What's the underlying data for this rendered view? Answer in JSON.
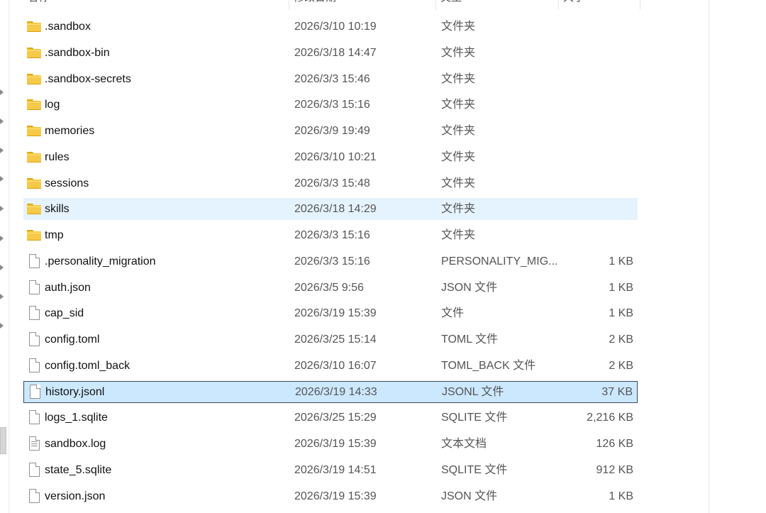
{
  "columns": {
    "name": "名称",
    "date": "修改日期",
    "type": "类型",
    "size": "大小"
  },
  "icons": {
    "folder": "folder-icon",
    "file": "file-icon",
    "text_file": "text-file-icon"
  },
  "accent": {
    "hover": "#e5f3ff",
    "selected": "#cce8ff",
    "selected_border": "#3a4a5e"
  },
  "rows": [
    {
      "name": ".sandbox",
      "date": "2026/3/10 10:19",
      "type": "文件夹",
      "size": "",
      "kind": "folder",
      "state": ""
    },
    {
      "name": ".sandbox-bin",
      "date": "2026/3/18 14:47",
      "type": "文件夹",
      "size": "",
      "kind": "folder",
      "state": ""
    },
    {
      "name": ".sandbox-secrets",
      "date": "2026/3/3 15:46",
      "type": "文件夹",
      "size": "",
      "kind": "folder",
      "state": ""
    },
    {
      "name": "log",
      "date": "2026/3/3 15:16",
      "type": "文件夹",
      "size": "",
      "kind": "folder",
      "state": ""
    },
    {
      "name": "memories",
      "date": "2026/3/9 19:49",
      "type": "文件夹",
      "size": "",
      "kind": "folder",
      "state": ""
    },
    {
      "name": "rules",
      "date": "2026/3/10 10:21",
      "type": "文件夹",
      "size": "",
      "kind": "folder",
      "state": ""
    },
    {
      "name": "sessions",
      "date": "2026/3/3 15:48",
      "type": "文件夹",
      "size": "",
      "kind": "folder",
      "state": ""
    },
    {
      "name": "skills",
      "date": "2026/3/18 14:29",
      "type": "文件夹",
      "size": "",
      "kind": "folder",
      "state": "hover"
    },
    {
      "name": "tmp",
      "date": "2026/3/3 15:16",
      "type": "文件夹",
      "size": "",
      "kind": "folder",
      "state": ""
    },
    {
      "name": ".personality_migration",
      "date": "2026/3/3 15:16",
      "type": "PERSONALITY_MIG...",
      "size": "1 KB",
      "kind": "file",
      "state": ""
    },
    {
      "name": "auth.json",
      "date": "2026/3/5 9:56",
      "type": "JSON 文件",
      "size": "1 KB",
      "kind": "file",
      "state": ""
    },
    {
      "name": "cap_sid",
      "date": "2026/3/19 15:39",
      "type": "文件",
      "size": "1 KB",
      "kind": "file",
      "state": ""
    },
    {
      "name": "config.toml",
      "date": "2026/3/25 15:14",
      "type": "TOML 文件",
      "size": "2 KB",
      "kind": "file",
      "state": ""
    },
    {
      "name": "config.toml_back",
      "date": "2026/3/10 16:07",
      "type": "TOML_BACK 文件",
      "size": "2 KB",
      "kind": "file",
      "state": ""
    },
    {
      "name": "history.jsonl",
      "date": "2026/3/19 14:33",
      "type": "JSONL 文件",
      "size": "37 KB",
      "kind": "file",
      "state": "selected"
    },
    {
      "name": "logs_1.sqlite",
      "date": "2026/3/25 15:29",
      "type": "SQLITE 文件",
      "size": "2,216 KB",
      "kind": "file",
      "state": ""
    },
    {
      "name": "sandbox.log",
      "date": "2026/3/19 15:39",
      "type": "文本文档",
      "size": "126 KB",
      "kind": "text",
      "state": ""
    },
    {
      "name": "state_5.sqlite",
      "date": "2026/3/19 14:51",
      "type": "SQLITE 文件",
      "size": "912 KB",
      "kind": "file",
      "state": ""
    },
    {
      "name": "version.json",
      "date": "2026/3/19 15:39",
      "type": "JSON 文件",
      "size": "1 KB",
      "kind": "file",
      "state": ""
    }
  ]
}
